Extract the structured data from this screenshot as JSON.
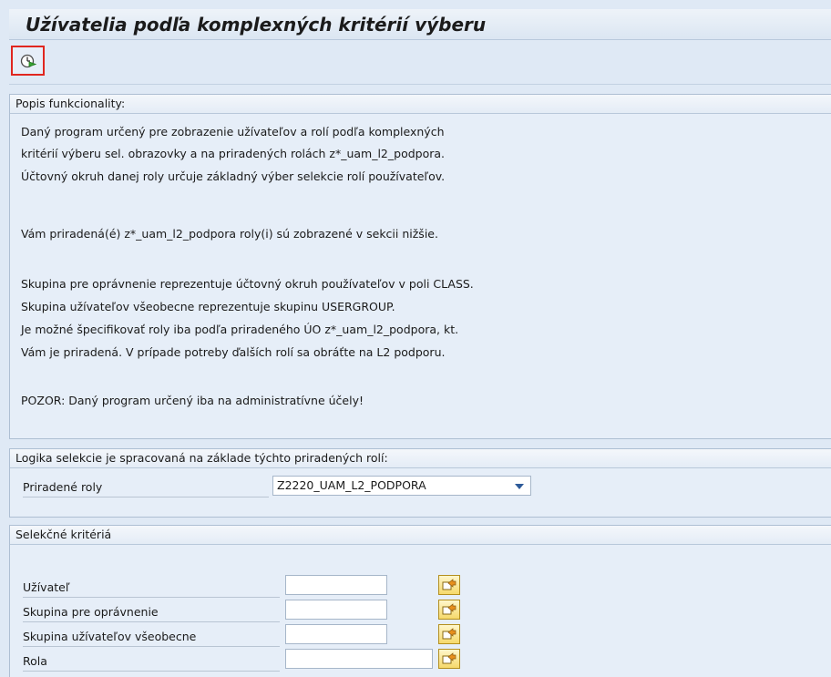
{
  "title": "Užívatelia podľa komplexných kritérií výberu",
  "toolbar": {
    "execute_icon": "execute-clock-icon"
  },
  "description": {
    "header": "Popis funkcionality:",
    "lines": [
      "Daný program určený pre zobrazenie užívateľov a rolí podľa komplexných",
      "kritérií výberu sel. obrazovky a na priradených rolách z*_uam_l2_podpora.",
      "Účtovný okruh danej roly určuje základný výber selekcie rolí používateľov.",
      "Vám priradená(é) z*_uam_l2_podpora roly(i) sú zobrazené v sekcii nižšie.",
      "Skupina pre oprávnenie reprezentuje účtovný okruh používateľov v poli CLASS.",
      "Skupina užívateľov všeobecne reprezentuje skupinu USERGROUP.",
      "Je možné špecifikovať roly iba podľa priradeného ÚO z*_uam_l2_podpora, kt.",
      "Vám je priradená. V prípade potreby ďalších rolí sa obráťte na L2 podporu.",
      "POZOR: Daný program určený iba na administratívne účely!"
    ]
  },
  "roles": {
    "header": "Logika selekcie je spracovaná na základe týchto priradených rolí:",
    "label": "Priradené roly",
    "value": "Z2220_UAM_L2_PODPORA"
  },
  "criteria": {
    "header": "Selekčné kritériá",
    "fields": [
      {
        "label": "Užívateľ",
        "value": ""
      },
      {
        "label": "Skupina pre oprávnenie",
        "value": ""
      },
      {
        "label": "Skupina užívateľov všeobecne",
        "value": ""
      },
      {
        "label": "Rola",
        "value": ""
      }
    ]
  }
}
